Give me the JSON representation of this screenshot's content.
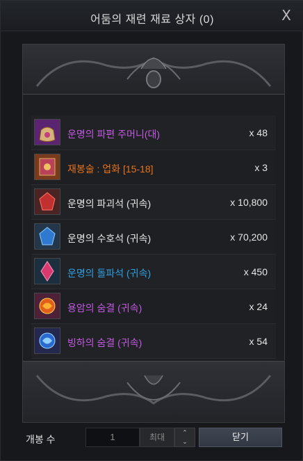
{
  "window": {
    "title": "어둠의 재련 재료 상자 (0)",
    "close_glyph": "X"
  },
  "items": [
    {
      "name": "운명의 파편 주머니(대)",
      "qty": "x 48",
      "color": "#c35ae0",
      "icon": "pouch-icon",
      "icon_bg": "#5a2470"
    },
    {
      "name": "재봉술 : 업화 [15-18]",
      "qty": "x 3",
      "color": "#e8731a",
      "icon": "book-icon",
      "icon_bg": "#7a3a1c"
    },
    {
      "name": "운명의 파괴석 (귀속)",
      "qty": "x 10,800",
      "color": "#e6e6e6",
      "icon": "red-stone-icon",
      "icon_bg": "#4a2424"
    },
    {
      "name": "운명의 수호석 (귀속)",
      "qty": "x 70,200",
      "color": "#e6e6e6",
      "icon": "blue-stone-icon",
      "icon_bg": "#23364a"
    },
    {
      "name": "운명의 돌파석 (귀속)",
      "qty": "x 450",
      "color": "#2fa0e0",
      "icon": "pink-crystal-icon",
      "icon_bg": "#1b2f3e"
    },
    {
      "name": "용암의 숨결 (귀속)",
      "qty": "x 24",
      "color": "#c35ae0",
      "icon": "lava-breath-icon",
      "icon_bg": "#4d2238"
    },
    {
      "name": "빙하의 숨결 (귀속)",
      "qty": "x 54",
      "color": "#c35ae0",
      "icon": "glacier-breath-icon",
      "icon_bg": "#24284e"
    }
  ],
  "footer": {
    "open_count_label": "개봉 수",
    "quantity_value": "1",
    "max_label": "최대",
    "stepper_up": "⌃",
    "stepper_down": "⌄",
    "close_label": "닫기"
  }
}
